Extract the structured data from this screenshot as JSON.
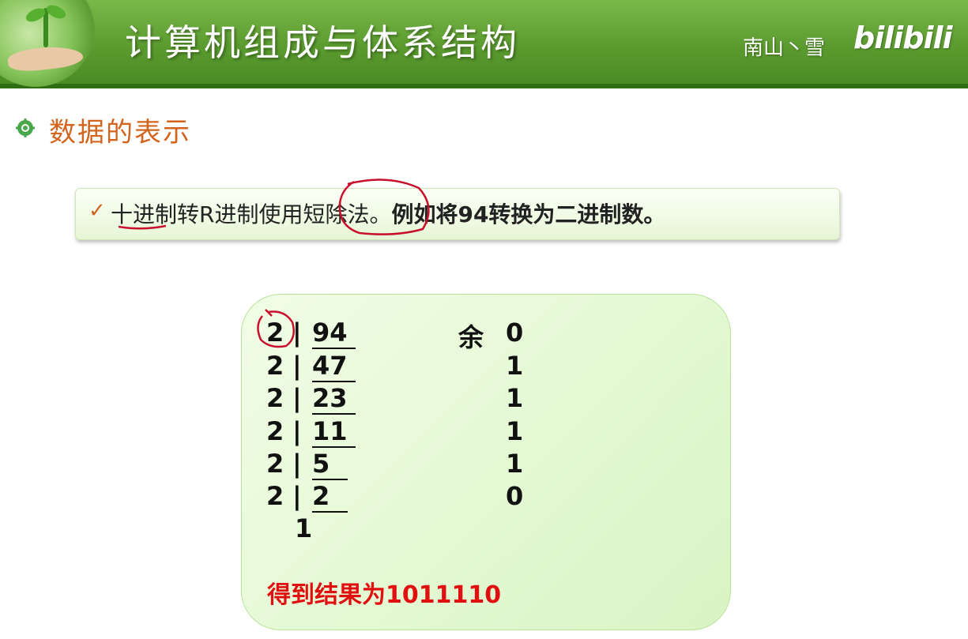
{
  "header": {
    "title": "计算机组成与体系结构",
    "author": "南山丶雪",
    "brand": "bilibili"
  },
  "section": {
    "title": "数据的表示"
  },
  "bullet": {
    "check": "✓",
    "text_normal": "十进制转R进制使用短除法。",
    "text_bold": "例如将94转换为二进制数。"
  },
  "division": {
    "remainder_label": "余",
    "rows": [
      {
        "divisor": "2",
        "bar": "|",
        "quotient": "94",
        "remainder": "0"
      },
      {
        "divisor": "2",
        "bar": "|",
        "quotient": "47",
        "remainder": "1"
      },
      {
        "divisor": "2",
        "bar": "|",
        "quotient": "23",
        "remainder": "1"
      },
      {
        "divisor": "2",
        "bar": "|",
        "quotient": "11",
        "remainder": "1"
      },
      {
        "divisor": "2",
        "bar": "|",
        "quotient": "5",
        "remainder": "1"
      },
      {
        "divisor": "2",
        "bar": "|",
        "quotient": "2",
        "remainder": "0"
      }
    ],
    "final_quotient": "1",
    "result": "得到结果为1011110"
  },
  "colors": {
    "header_green": "#5a9a2e",
    "section_orange": "#d2641e",
    "result_red": "#e01010",
    "annotation_red": "#c8102e"
  }
}
